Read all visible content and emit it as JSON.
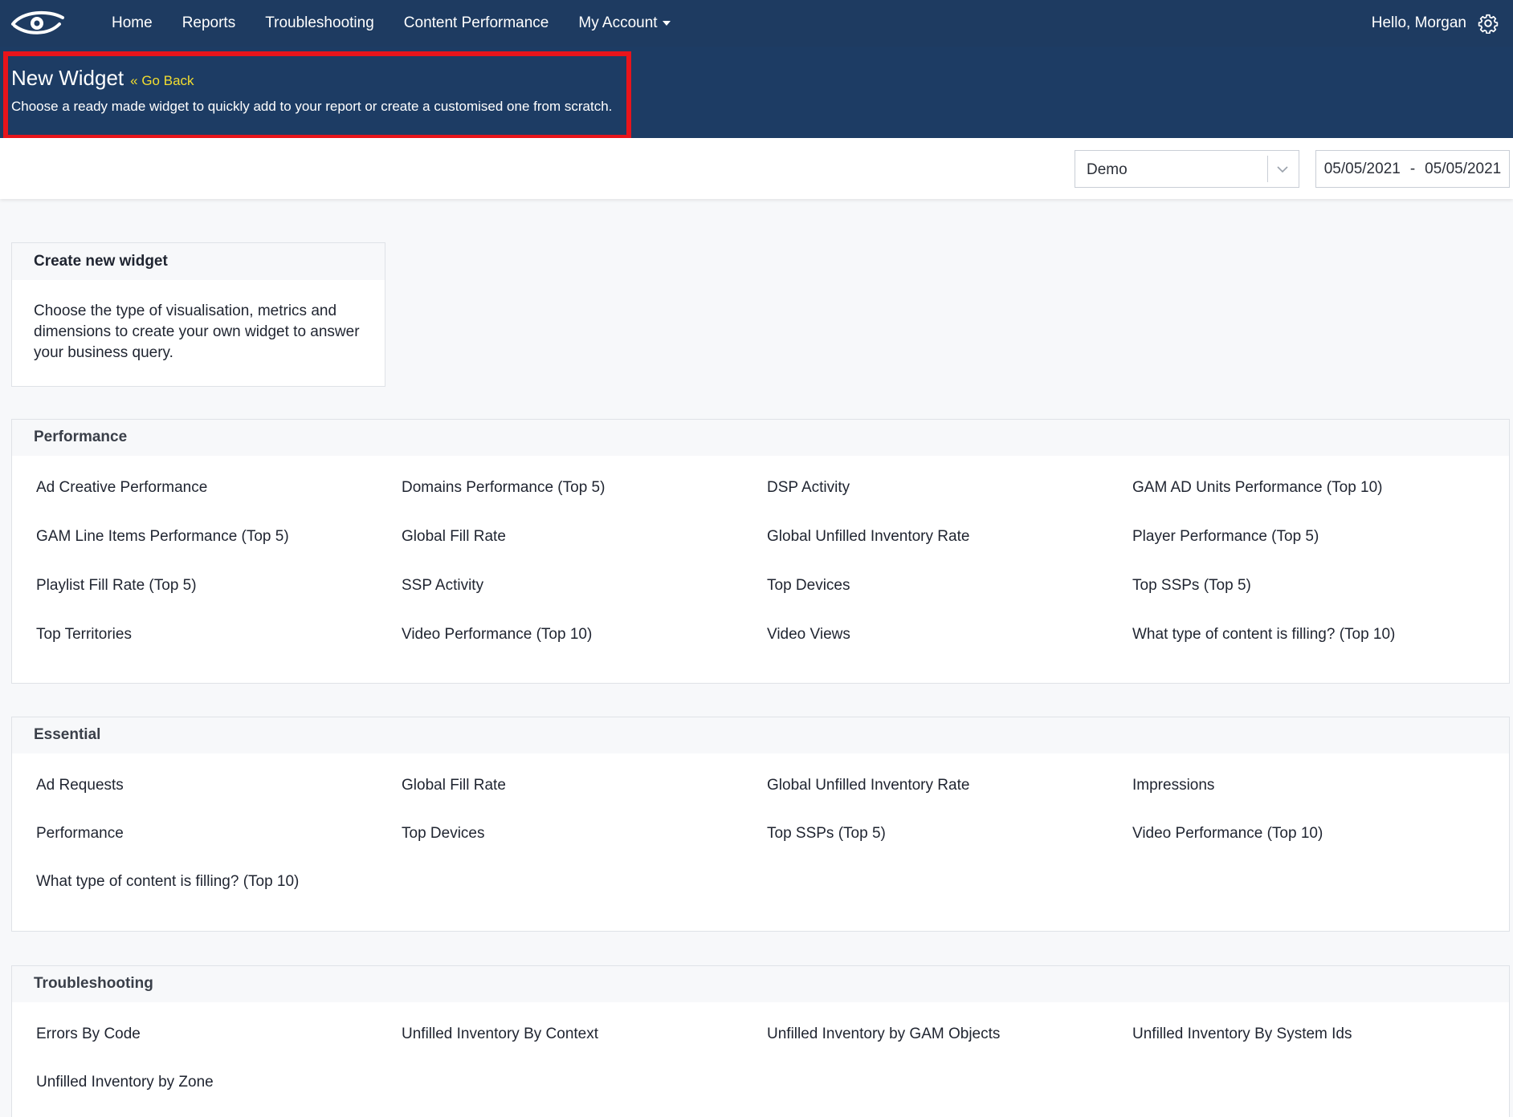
{
  "nav": {
    "logo": "eye-logo",
    "items": [
      {
        "label": "Home"
      },
      {
        "label": "Reports"
      },
      {
        "label": "Troubleshooting"
      },
      {
        "label": "Content Performance"
      },
      {
        "label": "My Account"
      }
    ],
    "greeting": "Hello, Morgan",
    "settings_icon": "gear-icon"
  },
  "header": {
    "title": "New Widget",
    "go_back": "« Go Back",
    "subtitle": "Choose a ready made widget to quickly add to your report or create a customised one from scratch.",
    "highlight_color": "#e8141b",
    "background": "#1d3c64"
  },
  "filters": {
    "account_select": "Demo",
    "date_start": "05/05/2021",
    "date_separator": "-",
    "date_end": "05/05/2021"
  },
  "create_card": {
    "title": "Create new widget",
    "description": "Choose the type of visualisation, metrics and dimensions to create your own widget to answer your business query."
  },
  "sections": {
    "performance": {
      "title": "Performance",
      "items": [
        "Ad Creative Performance",
        "Domains Performance (Top 5)",
        "DSP Activity",
        "GAM AD Units Performance (Top 10)",
        "GAM Line Items Performance (Top 5)",
        "Global Fill Rate",
        "Global Unfilled Inventory Rate",
        "Player Performance (Top 5)",
        "Playlist Fill Rate (Top 5)",
        "SSP Activity",
        "Top Devices",
        "Top SSPs (Top 5)",
        "Top Territories",
        "Video Performance (Top 10)",
        "Video Views",
        "What type of content is filling? (Top 10)"
      ]
    },
    "essential": {
      "title": "Essential",
      "items": [
        "Ad Requests",
        "Global Fill Rate",
        "Global Unfilled Inventory Rate",
        "Impressions",
        "Performance",
        "Top Devices",
        "Top SSPs (Top 5)",
        "Video Performance (Top 10)",
        "What type of content is filling? (Top 10)"
      ]
    },
    "troubleshooting": {
      "title": "Troubleshooting",
      "items": [
        "Errors By Code",
        "Unfilled Inventory By Context",
        "Unfilled Inventory by GAM Objects",
        "Unfilled Inventory By System Ids",
        "Unfilled Inventory by Zone"
      ]
    }
  }
}
